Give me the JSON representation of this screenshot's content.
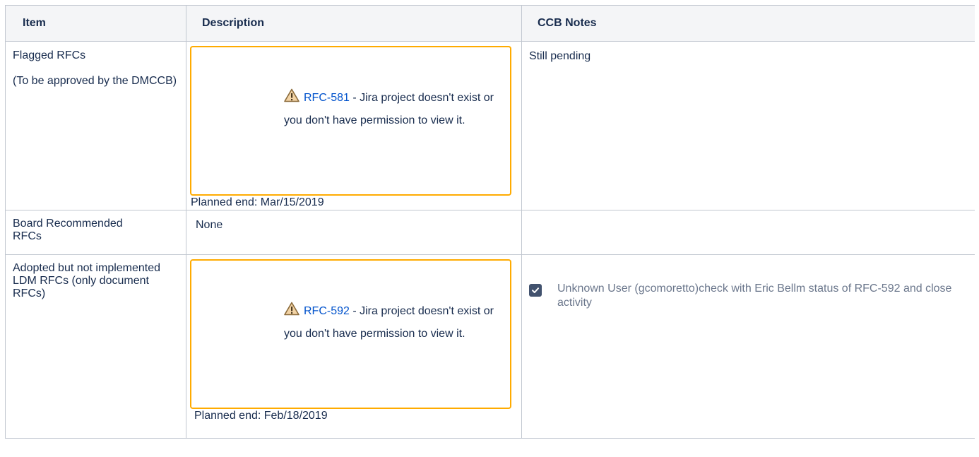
{
  "table": {
    "headers": {
      "item": "Item",
      "description": "Description",
      "notes": "CCB Notes"
    },
    "rows": [
      {
        "item_title": "Flagged RFCs",
        "item_sub": "(To be approved by the DMCCB)",
        "jira_key": "RFC-581",
        "jira_message_prefix": " - ",
        "jira_message": "Jira project doesn't exist or you don't have permission to view it.",
        "planned_end": "Planned end: Mar/15/2019",
        "notes": "Still pending"
      },
      {
        "item_title": "Board Recommended RFCs",
        "description": "None",
        "notes": ""
      },
      {
        "item_title": "Adopted but not implemented LDM RFCs (only document RFCs)",
        "jira_key": "RFC-592",
        "jira_message_prefix": " - ",
        "jira_message": "Jira project doesn't exist or you don't have permission to view it.",
        "planned_end": "Planned end: Feb/18/2019",
        "task": {
          "checked": true,
          "text": "Unknown User (gcomoretto)check with Eric Bellm status of RFC-592 and close activity"
        }
      }
    ]
  },
  "icons": {
    "warning": "warning-triangle-icon",
    "checkbox": "checkbox-checked-icon"
  },
  "colors": {
    "border": "#c1c7d0",
    "header_bg": "#f4f5f7",
    "jira_box_border": "#ffab00",
    "link": "#0052cc",
    "task_text": "#6b778c",
    "checkbox": "#42526e"
  }
}
